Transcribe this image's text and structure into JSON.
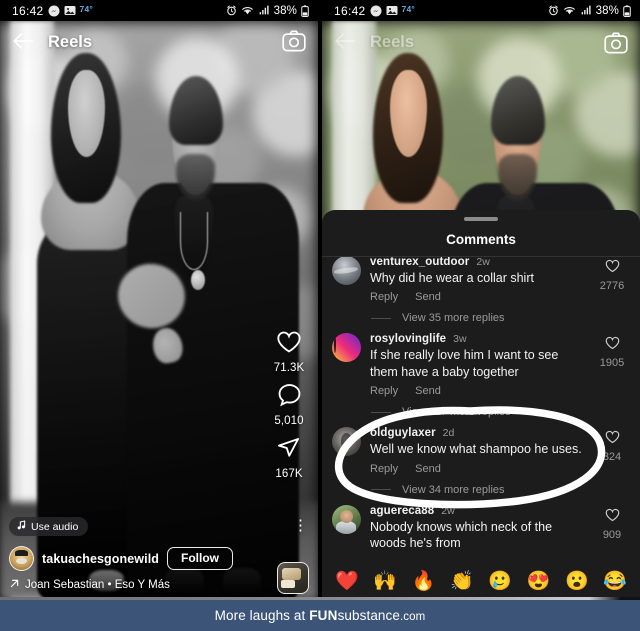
{
  "statusbar": {
    "time": "16:42",
    "temperature": "74°",
    "battery_percent": "38%",
    "icons": [
      "messenger-icon",
      "photos-icon",
      "alarm-icon",
      "wifi-icon",
      "signal-icon",
      "battery-icon"
    ]
  },
  "reels": {
    "title": "Reels",
    "back_icon": "back-arrow-icon",
    "camera_icon": "camera-icon",
    "actions": [
      {
        "icon": "heart-icon",
        "count": "71.3K"
      },
      {
        "icon": "comment-icon",
        "count": "5,010"
      },
      {
        "icon": "share-icon",
        "count": "167K"
      }
    ],
    "more_icon": "more-options-icon",
    "use_audio_label": "Use audio",
    "username": "takuachesgonewild",
    "follow_label": "Follow",
    "audio_label": "Joan Sebastian • Eso Y Más",
    "audio_arrow_icon": "arrow-up-right-icon",
    "album_thumb_name": "audio-album-thumbnail"
  },
  "comments_sheet": {
    "title": "Comments",
    "handle_name": "sheet-drag-handle",
    "comments": [
      {
        "username": "venturex_outdoor",
        "time": "2w",
        "text": "Why did he wear a collar shirt",
        "reply_label": "Reply",
        "send_label": "Send",
        "likes": "2776",
        "replies_label": "View 35 more replies",
        "avatar": "av-venturex"
      },
      {
        "username": "rosylovinglife",
        "time": "3w",
        "text": "If she really love him I want to see them have a baby together",
        "reply_label": "Reply",
        "send_label": "Send",
        "likes": "1905",
        "replies_label": "View 127 more replies",
        "avatar": "av-rosy"
      },
      {
        "username": "oldguylaxer",
        "time": "2d",
        "text": "Well we know what shampoo he uses.",
        "reply_label": "Reply",
        "send_label": "Send",
        "likes": "324",
        "replies_label": "View 34 more replies",
        "avatar": "av-oldguy"
      },
      {
        "username": "aguereca88",
        "time": "2w",
        "text": "Nobody knows which neck of the woods he's from",
        "reply_label": "Reply",
        "send_label": "Send",
        "likes": "909",
        "replies_label": "",
        "avatar": "av-aguereca"
      }
    ],
    "quick_emojis": [
      "❤️",
      "🙌",
      "🔥",
      "👏",
      "🥲",
      "😍",
      "😮",
      "😂"
    ],
    "annotation": "white-circle-highlight"
  },
  "footer": {
    "prefix": "More laughs at ",
    "brand_bold": "FUN",
    "brand_rest": "substance",
    "brand_tld": ".com",
    "background_color": "#3b5478"
  }
}
